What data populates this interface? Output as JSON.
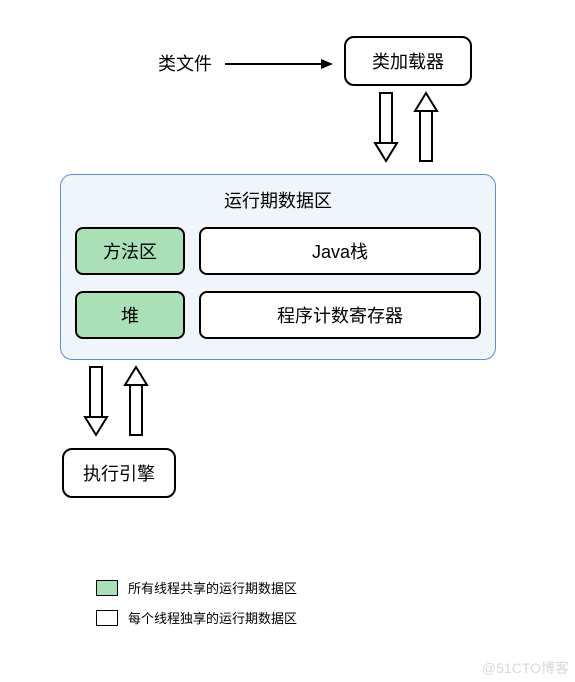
{
  "top": {
    "classFile": "类文件",
    "classLoader": "类加载器"
  },
  "runtime": {
    "title": "运行期数据区",
    "methodArea": "方法区",
    "javaStack": "Java栈",
    "heap": "堆",
    "pcRegister": "程序计数寄存器"
  },
  "bottom": {
    "executionEngine": "执行引擎"
  },
  "legend": {
    "shared": "所有线程共享的运行期数据区",
    "private": "每个线程独享的运行期数据区"
  },
  "watermark": "@51CTO博客",
  "chart_data": {
    "type": "diagram",
    "nodes": [
      {
        "id": "classFile",
        "label": "类文件",
        "shape": "text"
      },
      {
        "id": "classLoader",
        "label": "类加载器",
        "shape": "rounded-box"
      },
      {
        "id": "runtimeDataArea",
        "label": "运行期数据区",
        "shape": "container",
        "children": [
          {
            "id": "methodArea",
            "label": "方法区",
            "category": "shared"
          },
          {
            "id": "javaStack",
            "label": "Java栈",
            "category": "thread-private"
          },
          {
            "id": "heap",
            "label": "堆",
            "category": "shared"
          },
          {
            "id": "pcRegister",
            "label": "程序计数寄存器",
            "category": "thread-private"
          }
        ]
      },
      {
        "id": "executionEngine",
        "label": "执行引擎",
        "shape": "rounded-box"
      }
    ],
    "edges": [
      {
        "from": "classFile",
        "to": "classLoader",
        "style": "solid-arrow"
      },
      {
        "from": "classLoader",
        "to": "runtimeDataArea",
        "style": "double-hollow-arrow",
        "bidirectional": true
      },
      {
        "from": "runtimeDataArea",
        "to": "executionEngine",
        "style": "double-hollow-arrow",
        "bidirectional": true
      }
    ],
    "legend": [
      {
        "color": "#a9e0b8",
        "label": "所有线程共享的运行期数据区"
      },
      {
        "color": "#ffffff",
        "label": "每个线程独享的运行期数据区"
      }
    ]
  }
}
